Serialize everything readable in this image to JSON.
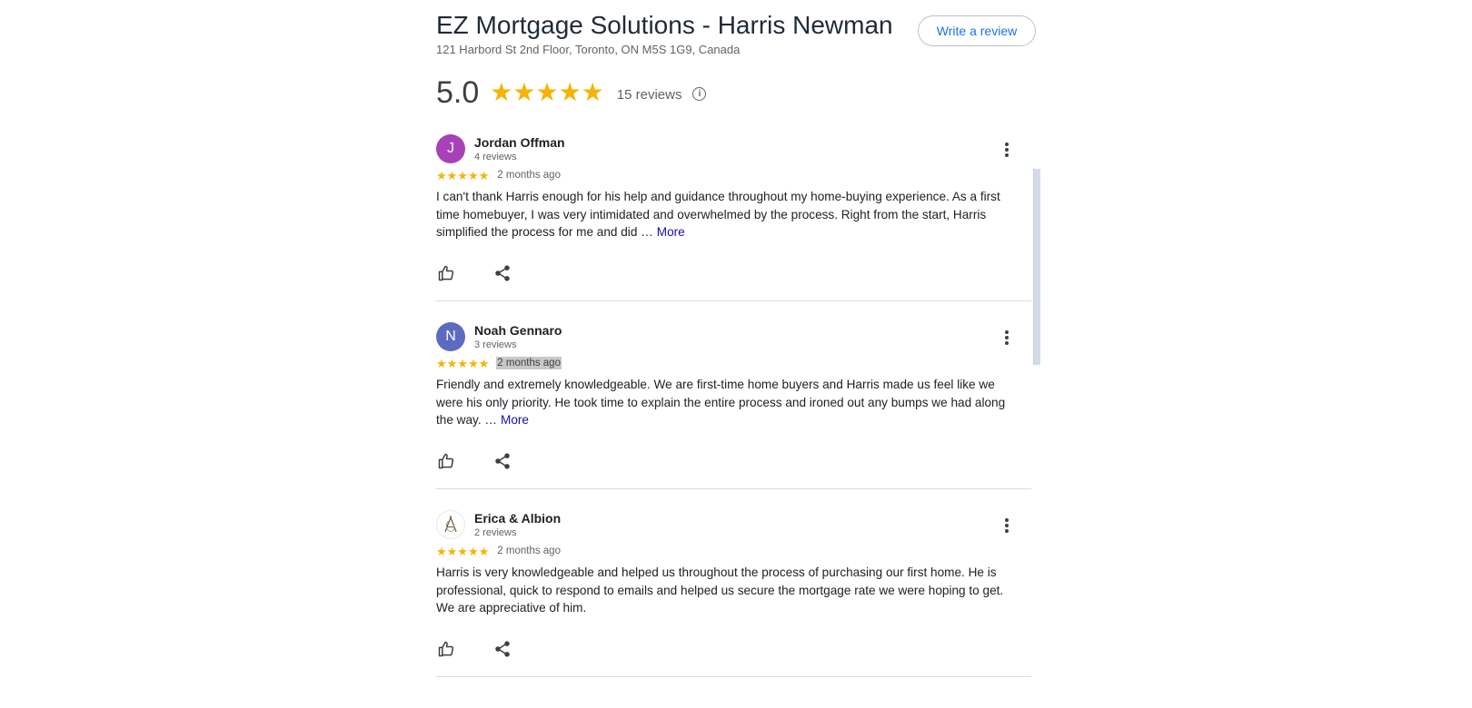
{
  "business": {
    "title": "EZ Mortgage Solutions - Harris Newman",
    "address": "121 Harbord St 2nd Floor, Toronto, ON M5S 1G9, Canada",
    "write_review_label": "Write a review"
  },
  "summary": {
    "rating": "5.0",
    "stars": "★★★★★",
    "count_label": "15 reviews",
    "info_glyph": "i"
  },
  "reviews": [
    {
      "initial": "J",
      "avatar_color": "#a642b5",
      "name": "Jordan Offman",
      "reviews_count": "4 reviews",
      "stars": "★★★★★",
      "date": "2 months ago",
      "text": "I can't thank Harris enough for his help and guidance throughout my home-buying experience. As a first time homebuyer, I was very intimidated and overwhelmed by the process. Right from the start, Harris simplified the process for me and did …",
      "more_label": "More"
    },
    {
      "initial": "N",
      "avatar_color": "#5c6bc0",
      "name": "Noah Gennaro",
      "reviews_count": "3 reviews",
      "stars": "★★★★★",
      "date": "2 months ago",
      "text": "Friendly and extremely knowledgeable. We are first-time home buyers and Harris made us feel like we were his only priority. He took time to explain the entire process and ironed out any bumps we had along the way. …",
      "more_label": "More"
    },
    {
      "initial": "",
      "avatar_color": "#ffffff",
      "name": "Erica & Albion",
      "reviews_count": "2 reviews",
      "stars": "★★★★★",
      "date": "2 months ago",
      "text": "Harris is very knowledgeable and helped us throughout the process of purchasing our first home. He is professional, quick to respond to emails and helped us secure the mortgage rate we were hoping to get. We are appreciative of him."
    }
  ],
  "icons": {
    "like": "thumbs-up-icon",
    "share": "share-icon",
    "menu": "more-vert-icon",
    "info": "info-icon"
  },
  "colors": {
    "star": "#f4b400",
    "link": "#1a0dab",
    "button_text": "#1a73e8"
  }
}
